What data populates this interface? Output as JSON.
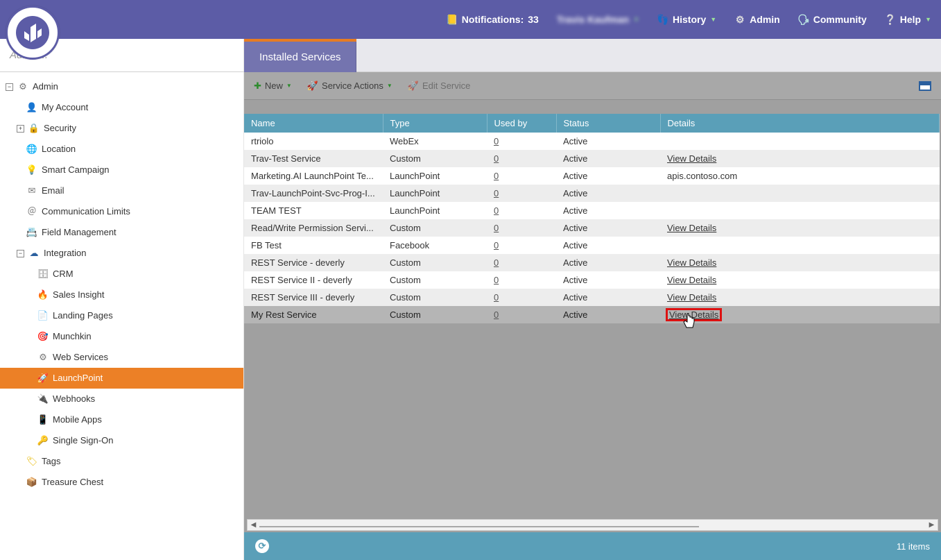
{
  "top": {
    "notifications_label": "Notifications:",
    "notifications_count": "33",
    "user_name": "Travis Kaufman",
    "history": "History",
    "admin": "Admin",
    "community": "Community",
    "help": "Help"
  },
  "breadcrumb_placeholder": "Admin...",
  "tab_label": "Installed Services",
  "toolbar": {
    "new": "New",
    "service_actions": "Service Actions",
    "edit_service": "Edit Service"
  },
  "sidebar": {
    "root": "Admin",
    "my_account": "My Account",
    "security": "Security",
    "location": "Location",
    "smart_campaign": "Smart Campaign",
    "email": "Email",
    "communication_limits": "Communication Limits",
    "field_management": "Field Management",
    "integration": "Integration",
    "crm": "CRM",
    "sales_insight": "Sales Insight",
    "landing_pages": "Landing Pages",
    "munchkin": "Munchkin",
    "web_services": "Web Services",
    "launchpoint": "LaunchPoint",
    "webhooks": "Webhooks",
    "mobile_apps": "Mobile Apps",
    "single_sign_on": "Single Sign-On",
    "tags": "Tags",
    "treasure_chest": "Treasure Chest"
  },
  "table": {
    "columns": {
      "name": "Name",
      "type": "Type",
      "used_by": "Used by",
      "status": "Status",
      "details": "Details"
    },
    "rows": [
      {
        "name": "rtriolo",
        "type": "WebEx",
        "used_by": "0",
        "status": "Active",
        "details": ""
      },
      {
        "name": "Trav-Test Service",
        "type": "Custom",
        "used_by": "0",
        "status": "Active",
        "details": "View Details"
      },
      {
        "name": "Marketing.AI LaunchPoint Te...",
        "type": "LaunchPoint",
        "used_by": "0",
        "status": "Active",
        "details": "apis.contoso.com"
      },
      {
        "name": "Trav-LaunchPoint-Svc-Prog-I...",
        "type": "LaunchPoint",
        "used_by": "0",
        "status": "Active",
        "details": ""
      },
      {
        "name": "TEAM TEST",
        "type": "LaunchPoint",
        "used_by": "0",
        "status": "Active",
        "details": ""
      },
      {
        "name": "Read/Write Permission Servi...",
        "type": "Custom",
        "used_by": "0",
        "status": "Active",
        "details": "View Details"
      },
      {
        "name": "FB Test",
        "type": "Facebook",
        "used_by": "0",
        "status": "Active",
        "details": ""
      },
      {
        "name": "REST Service - deverly",
        "type": "Custom",
        "used_by": "0",
        "status": "Active",
        "details": "View Details"
      },
      {
        "name": "REST Service II - deverly",
        "type": "Custom",
        "used_by": "0",
        "status": "Active",
        "details": "View Details"
      },
      {
        "name": "REST Service III - deverly",
        "type": "Custom",
        "used_by": "0",
        "status": "Active",
        "details": "View Details"
      },
      {
        "name": "My Rest Service",
        "type": "Custom",
        "used_by": "0",
        "status": "Active",
        "details": "View Details"
      }
    ]
  },
  "footer": {
    "count_label": "11 items"
  }
}
